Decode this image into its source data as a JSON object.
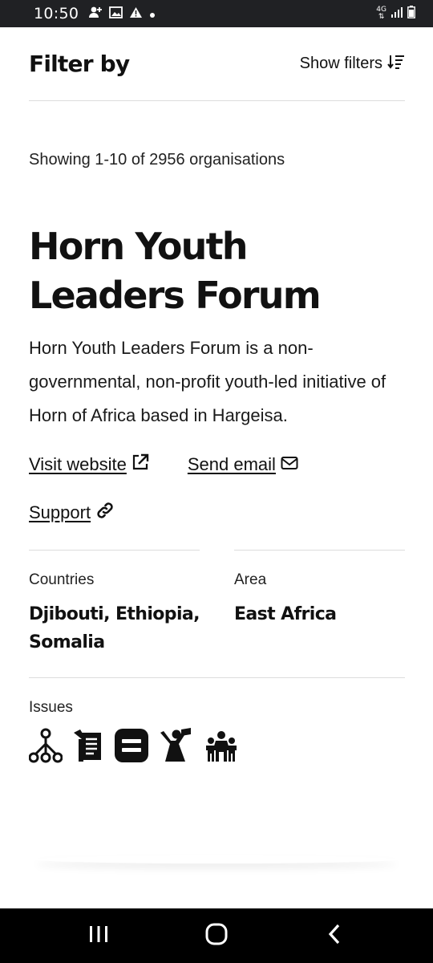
{
  "status_bar": {
    "time": "10:50",
    "network": "4G"
  },
  "header": {
    "title": "Filter by",
    "show_filters_label": "Show filters"
  },
  "results": {
    "count_text": "Showing 1-10 of 2956 organisations"
  },
  "organisation": {
    "name": "Horn Youth Leaders Forum",
    "description": "Horn Youth Leaders Forum is a non-governmental, non-profit youth-led initiative of Horn of Africa based in Hargeisa.",
    "links": {
      "website": "Visit website",
      "email": "Send email",
      "support": "Support"
    },
    "countries_label": "Countries",
    "countries_value": "Djibouti, Ethiopia, Somalia",
    "area_label": "Area",
    "area_value": "East Africa",
    "issues_label": "Issues",
    "issue_icons": [
      "network-icon",
      "document-list-icon",
      "equal-icon",
      "speaker-person-icon",
      "group-people-icon"
    ]
  }
}
